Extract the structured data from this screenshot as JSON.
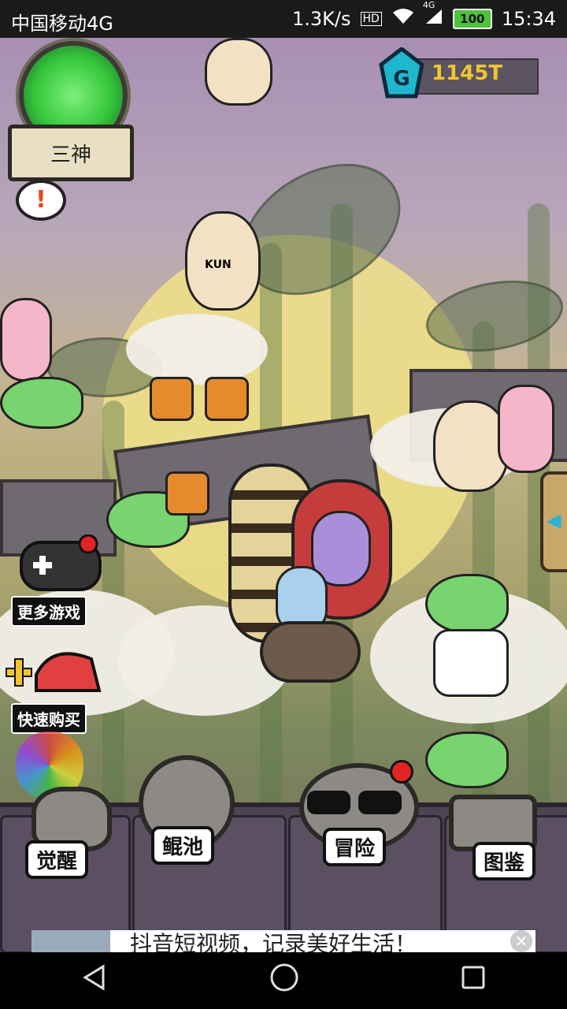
{
  "status_bar": {
    "carrier": "中国移动4G",
    "speed": "1.3K/s",
    "hd": "HD",
    "signal_label": "4G",
    "battery": "100",
    "time": "15:34"
  },
  "hud": {
    "mode_label": "三神",
    "currency_value": "1145T",
    "chat_icon_text": "!"
  },
  "side_buttons": {
    "more_games": "更多游戏",
    "quick_buy": "快速购买"
  },
  "bottom_nav": {
    "awaken": "觉醒",
    "kun_pool": "鲲池",
    "adventure": "冒险",
    "collection": "图鉴"
  },
  "ad": {
    "text": "抖音短视频，记录美好生活！"
  },
  "colors": {
    "currency": "#f2c530",
    "accent_green": "#78d46e",
    "panel": "#4d4353"
  },
  "char_labels": {
    "kun_tag": "KUN"
  }
}
